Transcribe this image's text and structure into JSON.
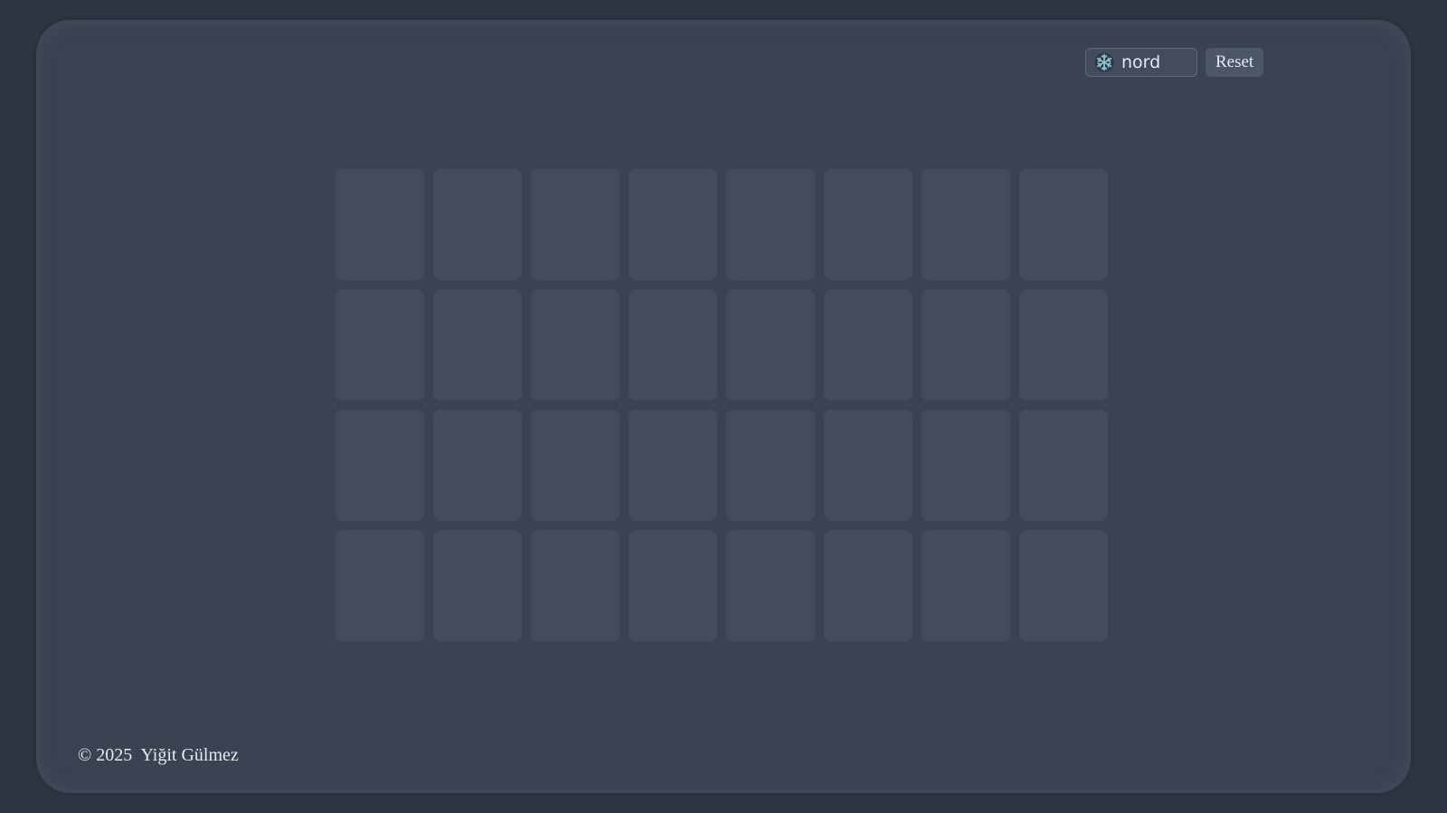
{
  "theme": {
    "selected": "nord",
    "icon": "snowflake-icon",
    "colors": {
      "background": "#2e3440",
      "panel": "#3b4252",
      "card": "#434c5e",
      "text": "#e5e9f0",
      "accent": "#88c0d0"
    }
  },
  "toolbar": {
    "reset_label": "Reset"
  },
  "board": {
    "rows": 4,
    "columns": 8,
    "cards_face_down": 32
  },
  "footer": {
    "copyright": "© 2025",
    "author": "Yiğit Gülmez"
  }
}
